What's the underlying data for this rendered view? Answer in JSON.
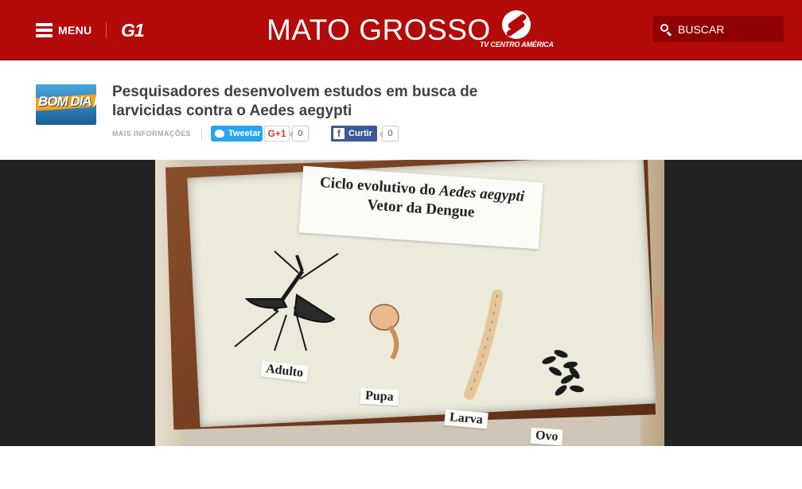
{
  "header": {
    "menu_label": "MENU",
    "portal_logo": "G1",
    "region_title": "MATO GROSSO",
    "affiliate_logo": "TV CENTRO AMÉRICA",
    "search_placeholder": "BUSCAR",
    "background_color": "#b30a0a",
    "icons": [
      "hamburger-menu-icon",
      "search-icon",
      "tv-centro-america-logo"
    ]
  },
  "article": {
    "program_thumbnail_text": "BOM DIA MT",
    "headline": "Pesquisadores desenvolvem estudos em busca de larvicidas contra o Aedes aegypti",
    "more_info_label": "MAIS INFORMAÇÕES",
    "social": {
      "tweet_label": "Tweetar",
      "gplus_label": "G+1",
      "gplus_count": "0",
      "facebook_label": "Curtir",
      "facebook_count": "0"
    }
  },
  "video": {
    "frame_title_line1_prefix": "Ciclo evolutivo do",
    "frame_title_line1_species": "Aedes aegypti",
    "frame_title_line2": "Vetor da Dengue",
    "stage_labels": [
      "Adulto",
      "Pupa",
      "Larva",
      "Ovo"
    ]
  }
}
